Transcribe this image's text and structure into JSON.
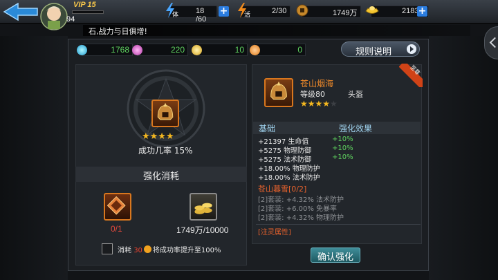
{
  "header": {
    "vip": "VIP 15",
    "level": "94",
    "stamina": {
      "value": "18 /60",
      "label": "体"
    },
    "vitality": {
      "value": "2/30",
      "label": "活"
    },
    "coins": "1749万",
    "gold": "2183"
  },
  "ticker": "石,战力与日俱增!",
  "stats": [
    "1768",
    "220",
    "10",
    "0"
  ],
  "rules_button": "规则说明",
  "left": {
    "stars": "★★★★",
    "success_rate": "成功几率 15%",
    "cost_title": "强化消耗",
    "mat1_count": "0/1",
    "mat2_count": "1749万/10000",
    "consume_prefix": "消耗",
    "consume_amount": "30",
    "consume_suffix": "将成功率提升至100%"
  },
  "item": {
    "tag": "至尊",
    "name": "苍山烟海",
    "level": "等级80",
    "slot": "头盔",
    "stars": "★★★★",
    "star_off": "★"
  },
  "attributes": {
    "base_header": "基础",
    "effect_header": "强化效果",
    "lines": [
      {
        "text": "+21397 生命值",
        "bonus": "+10%"
      },
      {
        "text": "+5275 物理防御",
        "bonus": "+10%"
      },
      {
        "text": "+5275 法术防御",
        "bonus": "+10%"
      },
      {
        "text": "+18.00% 物理防护",
        "bonus": ""
      },
      {
        "text": "+18.00% 法术防护",
        "bonus": ""
      }
    ]
  },
  "set": {
    "title": "苍山暮雪[0/2]",
    "lines": [
      "[2]套装: +4.32% 法术防护",
      "[2]套装: +6.00% 免暴率",
      "[2]套装: +4.32% 物理防护"
    ]
  },
  "spirit": "[注灵属性]",
  "confirm_button": "确认强化"
}
